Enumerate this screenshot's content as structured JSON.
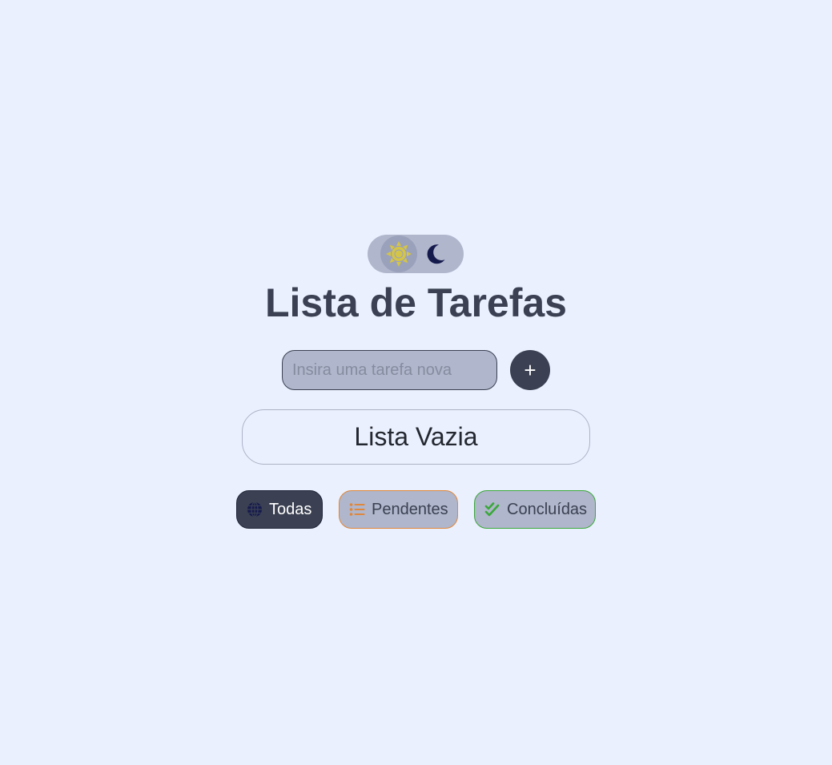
{
  "header": {
    "title": "Lista de Tarefas"
  },
  "theme_toggle": {
    "active_mode": "light",
    "sun_icon": "sun-icon",
    "moon_icon": "moon-icon"
  },
  "task_form": {
    "input_value": "",
    "input_placeholder": "Insira uma tarefa nova",
    "add_button_label": "+"
  },
  "task_list": {
    "empty_message": "Lista Vazia"
  },
  "filters": {
    "all": {
      "label": "Todas",
      "icon": "globe-icon",
      "active": true
    },
    "pending": {
      "label": "Pendentes",
      "icon": "list-icon"
    },
    "done": {
      "label": "Concluídas",
      "icon": "double-check-icon"
    }
  },
  "colors": {
    "background": "#eaf0fe",
    "primary": "#3b4152",
    "surface": "#b0b6cb",
    "pending_accent": "#e0873a",
    "done_accent": "#3aa83a",
    "sun": "#e2c631",
    "moon": "#151a4d"
  }
}
